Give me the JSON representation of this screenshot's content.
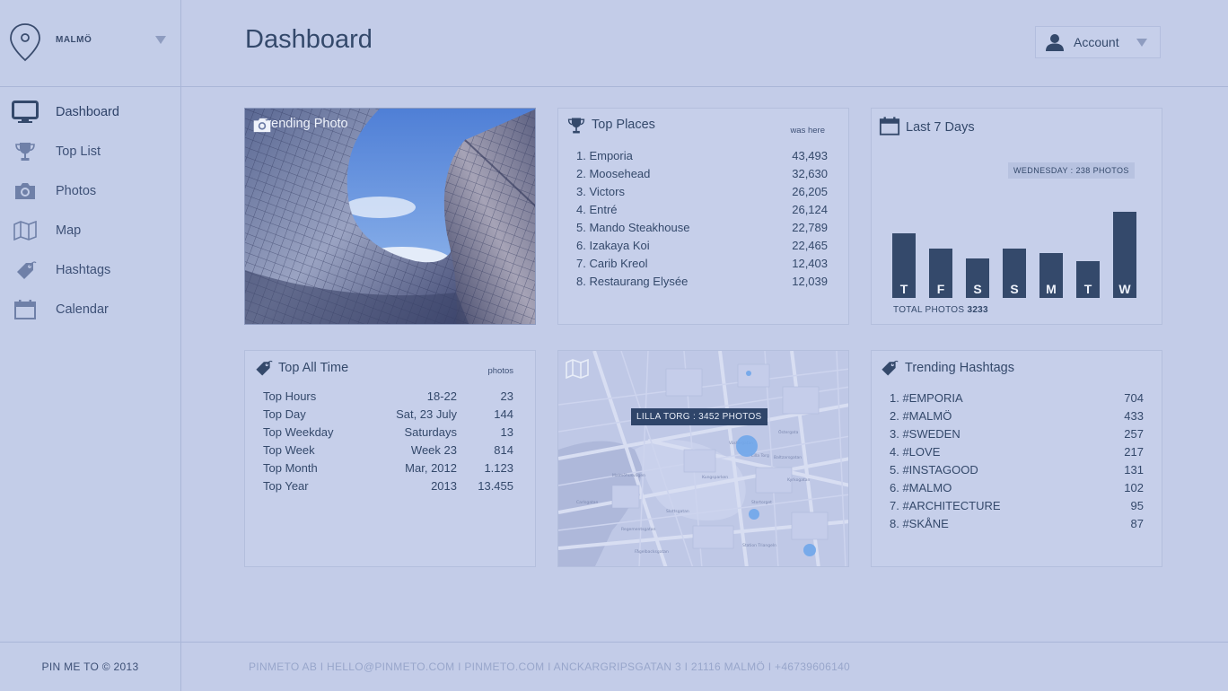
{
  "sidebar": {
    "city": "MALMÖ",
    "items": [
      {
        "label": "Dashboard",
        "icon": "monitor-icon"
      },
      {
        "label": "Top List",
        "icon": "trophy-icon"
      },
      {
        "label": "Photos",
        "icon": "camera-icon"
      },
      {
        "label": "Map",
        "icon": "map-icon"
      },
      {
        "label": "Hashtags",
        "icon": "tag-icon"
      },
      {
        "label": "Calendar",
        "icon": "calendar-icon"
      }
    ],
    "footer": "PIN ME TO © 2013"
  },
  "header": {
    "title": "Dashboard",
    "account_label": "Account"
  },
  "trending_photo": {
    "title": "Trending Photo"
  },
  "top_places": {
    "title": "Top Places",
    "col_header": "was here",
    "rows": [
      {
        "name": "1. Emporia",
        "value": "43,493"
      },
      {
        "name": "2. Moosehead",
        "value": "32,630"
      },
      {
        "name": "3. Victors",
        "value": "26,205"
      },
      {
        "name": "4. Entré",
        "value": "26,124"
      },
      {
        "name": "5. Mando Steakhouse",
        "value": "22,789"
      },
      {
        "name": "6. Izakaya Koi",
        "value": "22,465"
      },
      {
        "name": "7. Carib Kreol",
        "value": "12,403"
      },
      {
        "name": "8. Restaurang Elysée",
        "value": "12,039"
      }
    ]
  },
  "last_7_days": {
    "title": "Last 7 Days",
    "tooltip": "WEDNESDAY : 238 PHOTOS",
    "total_label": "TOTAL PHOTOS",
    "total_value": "3233",
    "days": [
      {
        "label": "T",
        "value": 0.6
      },
      {
        "label": "F",
        "value": 0.46
      },
      {
        "label": "S",
        "value": 0.37
      },
      {
        "label": "S",
        "value": 0.46
      },
      {
        "label": "M",
        "value": 0.42
      },
      {
        "label": "T",
        "value": 0.34
      },
      {
        "label": "W",
        "value": 0.8
      }
    ]
  },
  "top_all_time": {
    "title": "Top All Time",
    "col_header": "photos",
    "rows": [
      {
        "name": "Top Hours",
        "detail": "18-22",
        "value": "23"
      },
      {
        "name": "Top Day",
        "detail": "Sat, 23 July",
        "value": "144"
      },
      {
        "name": "Top Weekday",
        "detail": "Saturdays",
        "value": "13"
      },
      {
        "name": "Top Week",
        "detail": "Week 23",
        "value": "814"
      },
      {
        "name": "Top Month",
        "detail": "Mar, 2012",
        "value": "1.123"
      },
      {
        "name": "Top Year",
        "detail": "2013",
        "value": "13.455"
      }
    ]
  },
  "map": {
    "tooltip": "LILLA TORG : 3452 PHOTOS",
    "streets": [
      "Västergatan",
      "Östergata",
      "Baltzarsgatan",
      "Kungsparken",
      "Lilla Torg",
      "Stortorget",
      "Regementsgatan",
      "Station Triangeln",
      "Fågelbacksgatan",
      "Slottsgatan",
      "Kyrkogatan",
      "Carlsgatan",
      "Malmöhusvägen"
    ]
  },
  "trending_hashtags": {
    "title": "Trending Hashtags",
    "rows": [
      {
        "name": "1. #EMPORIA",
        "value": "704"
      },
      {
        "name": "2. #MALMÖ",
        "value": "433"
      },
      {
        "name": "3. #SWEDEN",
        "value": "257"
      },
      {
        "name": "4. #LOVE",
        "value": "217"
      },
      {
        "name": "5. #INSTAGOOD",
        "value": "131"
      },
      {
        "name": "6. #MALMO",
        "value": "102"
      },
      {
        "name": "7. #ARCHITECTURE",
        "value": "95"
      },
      {
        "name": "8. #SKÅNE",
        "value": "87"
      }
    ]
  },
  "footer": {
    "text": "PINMETO AB I HELLO@PINMETO.COM I PINMETO.COM I ANCKARGRIPSGATAN  3 I 21116 MALMÖ I +46739606140"
  },
  "colors": {
    "background": "#c3cce8",
    "card": "#c6cfea",
    "dark": "#34496b",
    "map_bubble": "#6fa6ea"
  }
}
